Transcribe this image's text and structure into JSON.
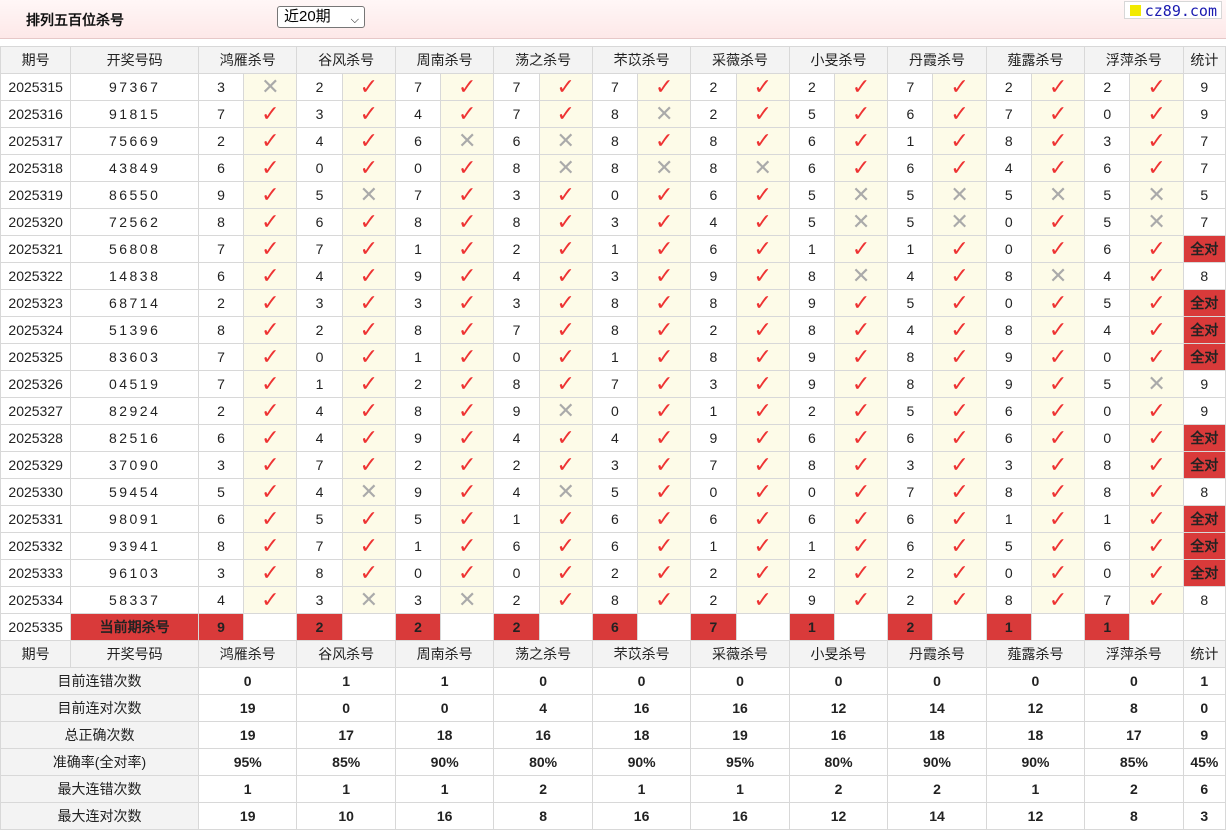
{
  "page_title": "排列五百位杀号",
  "period_select": {
    "value": "近20期"
  },
  "logo": {
    "text": "cz89.com"
  },
  "headers": {
    "period": "期号",
    "draw": "开奖号码",
    "stat": "统计"
  },
  "experts": [
    "鸿雁杀号",
    "谷风杀号",
    "周南杀号",
    "荡之杀号",
    "芣苡杀号",
    "采薇杀号",
    "小旻杀号",
    "丹霞杀号",
    "薤露杀号",
    "浮萍杀号"
  ],
  "rows": [
    {
      "period": "2025315",
      "draw": "97367",
      "kills": [
        "3",
        "2",
        "7",
        "7",
        "7",
        "2",
        "2",
        "7",
        "2",
        "2"
      ],
      "hits": [
        0,
        1,
        1,
        1,
        1,
        1,
        1,
        1,
        1,
        1
      ],
      "stat": "9"
    },
    {
      "period": "2025316",
      "draw": "91815",
      "kills": [
        "7",
        "3",
        "4",
        "7",
        "8",
        "2",
        "5",
        "6",
        "7",
        "0"
      ],
      "hits": [
        1,
        1,
        1,
        1,
        0,
        1,
        1,
        1,
        1,
        1
      ],
      "stat": "9"
    },
    {
      "period": "2025317",
      "draw": "75669",
      "kills": [
        "2",
        "4",
        "6",
        "6",
        "8",
        "8",
        "6",
        "1",
        "8",
        "3"
      ],
      "hits": [
        1,
        1,
        0,
        0,
        1,
        1,
        1,
        1,
        1,
        1
      ],
      "stat": "7"
    },
    {
      "period": "2025318",
      "draw": "43849",
      "kills": [
        "6",
        "0",
        "0",
        "8",
        "8",
        "8",
        "6",
        "6",
        "4",
        "6"
      ],
      "hits": [
        1,
        1,
        1,
        0,
        0,
        0,
        1,
        1,
        1,
        1
      ],
      "stat": "7"
    },
    {
      "period": "2025319",
      "draw": "86550",
      "kills": [
        "9",
        "5",
        "7",
        "3",
        "0",
        "6",
        "5",
        "5",
        "5",
        "5"
      ],
      "hits": [
        1,
        0,
        1,
        1,
        1,
        1,
        0,
        0,
        0,
        0
      ],
      "stat": "5"
    },
    {
      "period": "2025320",
      "draw": "72562",
      "kills": [
        "8",
        "6",
        "8",
        "8",
        "3",
        "4",
        "5",
        "5",
        "0",
        "5"
      ],
      "hits": [
        1,
        1,
        1,
        1,
        1,
        1,
        0,
        0,
        1,
        0
      ],
      "stat": "7"
    },
    {
      "period": "2025321",
      "draw": "56808",
      "kills": [
        "7",
        "7",
        "1",
        "2",
        "1",
        "6",
        "1",
        "1",
        "0",
        "6"
      ],
      "hits": [
        1,
        1,
        1,
        1,
        1,
        1,
        1,
        1,
        1,
        1
      ],
      "stat": "全对"
    },
    {
      "period": "2025322",
      "draw": "14838",
      "kills": [
        "6",
        "4",
        "9",
        "4",
        "3",
        "9",
        "8",
        "4",
        "8",
        "4"
      ],
      "hits": [
        1,
        1,
        1,
        1,
        1,
        1,
        0,
        1,
        0,
        1
      ],
      "stat": "8"
    },
    {
      "period": "2025323",
      "draw": "68714",
      "kills": [
        "2",
        "3",
        "3",
        "3",
        "8",
        "8",
        "9",
        "5",
        "0",
        "5"
      ],
      "hits": [
        1,
        1,
        1,
        1,
        1,
        1,
        1,
        1,
        1,
        1
      ],
      "stat": "全对"
    },
    {
      "period": "2025324",
      "draw": "51396",
      "kills": [
        "8",
        "2",
        "8",
        "7",
        "8",
        "2",
        "8",
        "4",
        "8",
        "4"
      ],
      "hits": [
        1,
        1,
        1,
        1,
        1,
        1,
        1,
        1,
        1,
        1
      ],
      "stat": "全对"
    },
    {
      "period": "2025325",
      "draw": "83603",
      "kills": [
        "7",
        "0",
        "1",
        "0",
        "1",
        "8",
        "9",
        "8",
        "9",
        "0"
      ],
      "hits": [
        1,
        1,
        1,
        1,
        1,
        1,
        1,
        1,
        1,
        1
      ],
      "stat": "全对"
    },
    {
      "period": "2025326",
      "draw": "04519",
      "kills": [
        "7",
        "1",
        "2",
        "8",
        "7",
        "3",
        "9",
        "8",
        "9",
        "5"
      ],
      "hits": [
        1,
        1,
        1,
        1,
        1,
        1,
        1,
        1,
        1,
        0
      ],
      "stat": "9"
    },
    {
      "period": "2025327",
      "draw": "82924",
      "kills": [
        "2",
        "4",
        "8",
        "9",
        "0",
        "1",
        "2",
        "5",
        "6",
        "0"
      ],
      "hits": [
        1,
        1,
        1,
        0,
        1,
        1,
        1,
        1,
        1,
        1
      ],
      "stat": "9"
    },
    {
      "period": "2025328",
      "draw": "82516",
      "kills": [
        "6",
        "4",
        "9",
        "4",
        "4",
        "9",
        "6",
        "6",
        "6",
        "0"
      ],
      "hits": [
        1,
        1,
        1,
        1,
        1,
        1,
        1,
        1,
        1,
        1
      ],
      "stat": "全对"
    },
    {
      "period": "2025329",
      "draw": "37090",
      "kills": [
        "3",
        "7",
        "2",
        "2",
        "3",
        "7",
        "8",
        "3",
        "3",
        "8"
      ],
      "hits": [
        1,
        1,
        1,
        1,
        1,
        1,
        1,
        1,
        1,
        1
      ],
      "stat": "全对"
    },
    {
      "period": "2025330",
      "draw": "59454",
      "kills": [
        "5",
        "4",
        "9",
        "4",
        "5",
        "0",
        "0",
        "7",
        "8",
        "8"
      ],
      "hits": [
        1,
        0,
        1,
        0,
        1,
        1,
        1,
        1,
        1,
        1
      ],
      "stat": "8"
    },
    {
      "period": "2025331",
      "draw": "98091",
      "kills": [
        "6",
        "5",
        "5",
        "1",
        "6",
        "6",
        "6",
        "6",
        "1",
        "1"
      ],
      "hits": [
        1,
        1,
        1,
        1,
        1,
        1,
        1,
        1,
        1,
        1
      ],
      "stat": "全对"
    },
    {
      "period": "2025332",
      "draw": "93941",
      "kills": [
        "8",
        "7",
        "1",
        "6",
        "6",
        "1",
        "1",
        "6",
        "5",
        "6"
      ],
      "hits": [
        1,
        1,
        1,
        1,
        1,
        1,
        1,
        1,
        1,
        1
      ],
      "stat": "全对"
    },
    {
      "period": "2025333",
      "draw": "96103",
      "kills": [
        "3",
        "8",
        "0",
        "0",
        "2",
        "2",
        "2",
        "2",
        "0",
        "0"
      ],
      "hits": [
        1,
        1,
        1,
        1,
        1,
        1,
        1,
        1,
        1,
        1
      ],
      "stat": "全对"
    },
    {
      "period": "2025334",
      "draw": "58337",
      "kills": [
        "4",
        "3",
        "3",
        "2",
        "8",
        "2",
        "9",
        "2",
        "8",
        "7"
      ],
      "hits": [
        1,
        0,
        0,
        1,
        1,
        1,
        1,
        1,
        1,
        1
      ],
      "stat": "8"
    }
  ],
  "current": {
    "period": "2025335",
    "label": "当前期杀号",
    "kills": [
      "9",
      "2",
      "2",
      "2",
      "6",
      "7",
      "1",
      "2",
      "1",
      "1"
    ]
  },
  "summary": [
    {
      "label": "目前连错次数",
      "values": [
        "0",
        "1",
        "1",
        "0",
        "0",
        "0",
        "0",
        "0",
        "0",
        "0"
      ],
      "stat": "1",
      "kind": "num"
    },
    {
      "label": "目前连对次数",
      "values": [
        "19",
        "0",
        "0",
        "4",
        "16",
        "16",
        "12",
        "14",
        "12",
        "8"
      ],
      "stat": "0",
      "kind": "num"
    },
    {
      "label": "总正确次数",
      "values": [
        "19",
        "17",
        "18",
        "16",
        "18",
        "19",
        "16",
        "18",
        "18",
        "17"
      ],
      "stat": "9",
      "kind": "num"
    },
    {
      "label": "准确率(全对率)",
      "values": [
        "95%",
        "85%",
        "90%",
        "80%",
        "90%",
        "95%",
        "80%",
        "90%",
        "90%",
        "85%"
      ],
      "stat": "45%",
      "kind": "rate"
    },
    {
      "label": "最大连错次数",
      "values": [
        "1",
        "1",
        "1",
        "2",
        "1",
        "1",
        "2",
        "2",
        "1",
        "2"
      ],
      "stat": "6",
      "kind": "num"
    },
    {
      "label": "最大连对次数",
      "values": [
        "19",
        "10",
        "16",
        "8",
        "16",
        "16",
        "12",
        "14",
        "12",
        "8"
      ],
      "stat": "3",
      "kind": "num"
    }
  ],
  "icons": {
    "hit": "check-icon",
    "miss": "cross-icon"
  },
  "colors": {
    "accent_red": "#d93a3a",
    "number_red": "#e33333",
    "summary_blue": "#1a1acc",
    "mark_bg": "#fdfbe8"
  }
}
